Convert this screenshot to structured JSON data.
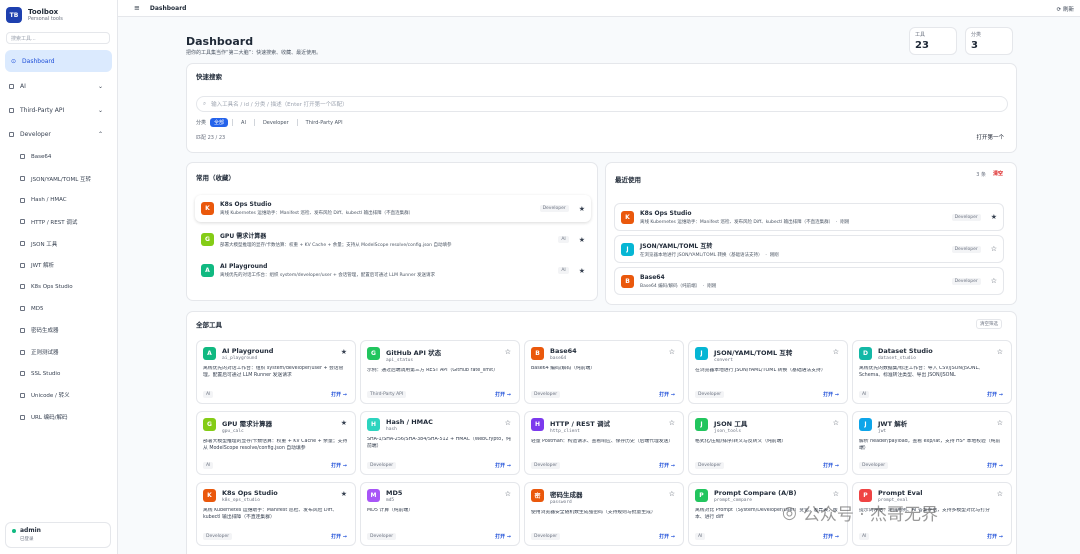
{
  "brand": {
    "logo": "TB",
    "title": "Toolbox",
    "subtitle": "Personal tools"
  },
  "sidebar": {
    "search_placeholder": "搜索工具...",
    "dashboard": "Dashboard",
    "groups": [
      {
        "label": "AI"
      },
      {
        "label": "Third-Party API"
      },
      {
        "label": "Developer"
      }
    ],
    "sub_items": [
      "Base64",
      "JSON/YAML/TOML 互转",
      "Hash / HMAC",
      "HTTP / REST 调试",
      "JSON 工具",
      "JWT 解析",
      "K8s Ops Studio",
      "MD5",
      "密码生成器",
      "正则测试器",
      "SSL Studio",
      "Unicode / 转义",
      "URL 编码/解码"
    ],
    "user": {
      "name": "admin",
      "status": "已登录"
    }
  },
  "topbar": {
    "title": "Dashboard",
    "refresh": "刷新"
  },
  "header": {
    "title": "Dashboard",
    "subtitle": "把你的工具集当作“第二大脑”：快速搜索、收藏、最近使用。"
  },
  "stats": [
    {
      "label": "工具",
      "value": "23"
    },
    {
      "label": "分类",
      "value": "3"
    }
  ],
  "quick": {
    "title": "快速搜索",
    "placeholder": "输入工具名 / id / 分类 / 描述（Enter 打开第一个匹配）",
    "cat_label": "分类",
    "cats": [
      "全部",
      "AI",
      "Developer",
      "Third-Party API"
    ],
    "matched": "匹配 23 / 23",
    "open_first": "打开第一个"
  },
  "favorites": {
    "title": "常用（收藏）",
    "items": [
      {
        "icon": "K",
        "color": "#ea580c",
        "name": "K8s Ops Studio",
        "desc": "离线 Kubernetes 运维助手：Manifest 巡检、发布风险 Diff、kubectl 输出排障（不直连集群）",
        "tag": "Developer"
      },
      {
        "icon": "G",
        "color": "#84cc16",
        "name": "GPU 需求计算器",
        "desc": "部署大模型推理的显存/卡数估算：权重 + KV Cache + 余量；支持从 ModelScope resolve/config.json 自动填参",
        "tag": "AI"
      },
      {
        "icon": "A",
        "color": "#10b981",
        "name": "AI Playground",
        "desc": "离线优先的对话工作台：组织 system/developer/user + 会话管理，配置后可通过 LLM Runner 发送请求",
        "tag": "AI"
      }
    ]
  },
  "recent": {
    "title": "最近使用",
    "count": "3 条",
    "clear": "清空",
    "items": [
      {
        "icon": "K",
        "color": "#ea580c",
        "name": "K8s Ops Studio",
        "desc": "离线 Kubernetes 运维助手：Manifest 巡检、发布风险 Diff、kubectl 输出排障（不直连集群）",
        "when": "刚刚",
        "tag": "Developer"
      },
      {
        "icon": "J",
        "color": "#06b6d4",
        "name": "JSON/YAML/TOML 互转",
        "desc": "在浏览器本地进行 JSON/YAML/TOML 转换（基础语法支持）",
        "when": "刚刚",
        "tag": "Developer"
      },
      {
        "icon": "B",
        "color": "#ea580c",
        "name": "Base64",
        "desc": "Base64 编码/解码（纯前端）",
        "when": "刚刚",
        "tag": "Developer"
      }
    ]
  },
  "all": {
    "title": "全部工具",
    "clear_filter": "清空筛选",
    "open_label": "打开 →",
    "tools": [
      {
        "icon": "A",
        "color": "#10b981",
        "name": "AI Playground",
        "id": "ai_playground",
        "desc": "离线优先的对话工作台：组织 system/developer/user + 会话管理，配置后可通过 LLM Runner 发送请求",
        "tag": "AI",
        "star": "★"
      },
      {
        "icon": "G",
        "color": "#22c55e",
        "name": "GitHub API 状态",
        "id": "api_status",
        "desc": "示例：通过后端调用第三方 REST API（GitHub rate_limit）",
        "tag": "Third-Party API",
        "star": "☆"
      },
      {
        "icon": "B",
        "color": "#ea580c",
        "name": "Base64",
        "id": "base64",
        "desc": "Base64 编码/解码（纯前端）",
        "tag": "Developer",
        "star": "☆"
      },
      {
        "icon": "J",
        "color": "#06b6d4",
        "name": "JSON/YAML/TOML 互转",
        "id": "convert",
        "desc": "在浏览器本地进行 JSON/YAML/TOML 转换（基础语法支持）",
        "tag": "Developer",
        "star": "☆"
      },
      {
        "icon": "D",
        "color": "#14b8a6",
        "name": "Dataset Studio",
        "id": "dataset_studio",
        "desc": "离线优先的数据集/标注工作台：导入 CSV/JSON/JSONL、Schema、标准转注类型、导出 JSON/JSONL",
        "tag": "AI",
        "star": "☆"
      },
      {
        "icon": "G",
        "color": "#84cc16",
        "name": "GPU 需求计算器",
        "id": "gpu_calc",
        "desc": "部署大模型推理的显存/卡数估算：权重 + KV Cache + 余量；支持从 ModelScope resolve/config.json 自动填参",
        "tag": "AI",
        "star": "★"
      },
      {
        "icon": "H",
        "color": "#2dd4bf",
        "name": "Hash / HMAC",
        "id": "hash",
        "desc": "SHA-1/SHA-256/SHA-384/SHA-512 + HMAC（WebCrypto，纯前端）",
        "tag": "Developer",
        "star": "☆"
      },
      {
        "icon": "H",
        "color": "#7c3aed",
        "name": "HTTP / REST 调试",
        "id": "http_client",
        "desc": "轻量 Postman：构造请求、查看响应、保存历史（后端代理发送）",
        "tag": "Developer",
        "star": "☆"
      },
      {
        "icon": "J",
        "color": "#22c55e",
        "name": "JSON 工具",
        "id": "json_tools",
        "desc": "格式化/压缩/排序/转义与反转义（纯前端）",
        "tag": "Developer",
        "star": "☆"
      },
      {
        "icon": "J",
        "color": "#0ea5e9",
        "name": "JWT 解析",
        "id": "jwt",
        "desc": "解析 header/payload，查看 exp/iat，支持 HS* 本地校验（纯前端）",
        "tag": "Developer",
        "star": "☆"
      },
      {
        "icon": "K",
        "color": "#ea580c",
        "name": "K8s Ops Studio",
        "id": "k8s_ops_studio",
        "desc": "离线 Kubernetes 运维助手：Manifest 巡检、发布风险 Diff、kubectl 输出排障（不直连集群）",
        "tag": "Developer",
        "star": "★"
      },
      {
        "icon": "M",
        "color": "#a855f7",
        "name": "MD5",
        "id": "md5",
        "desc": "MD5 计算（纯前端）",
        "tag": "Developer",
        "star": "☆"
      },
      {
        "icon": "密",
        "color": "#ea580c",
        "name": "密码生成器",
        "id": "password",
        "desc": "使用浏览器安全随机数生成强密码（支持规则与批量生成）",
        "tag": "Developer",
        "star": "☆"
      },
      {
        "icon": "P",
        "color": "#22c55e",
        "name": "Prompt Compare (A/B)",
        "id": "prompt_compare",
        "desc": "离线对比 Prompt（System/Developer/User）变化，差异表，版本、进行 diff",
        "tag": "AI",
        "star": "☆"
      },
      {
        "icon": "P",
        "color": "#ef4444",
        "name": "Prompt Eval",
        "id": "prompt_eval",
        "desc": "提示词评估：测试用例、AI 答案评估，支持多模型对比与打分",
        "tag": "AI",
        "star": "☆"
      }
    ]
  },
  "watermark": "公众号 · 杰哥无界"
}
